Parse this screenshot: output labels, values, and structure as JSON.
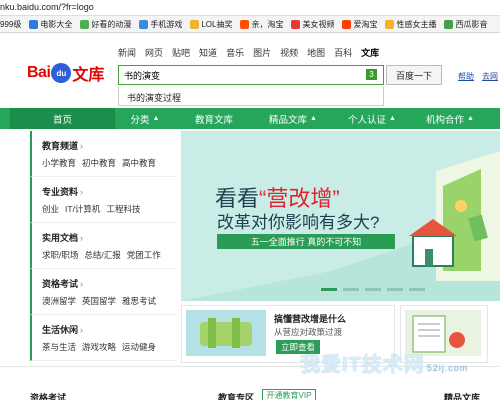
{
  "url": "nku.baidu.com/?fr=logo",
  "bookmarks": [
    {
      "label": "999级",
      "color": "#ffffff"
    },
    {
      "label": "电影大全",
      "color": "#2e7ad8"
    },
    {
      "label": "好看的动漫",
      "color": "#4caf50"
    },
    {
      "label": "手机游戏",
      "color": "#3a8bd8"
    },
    {
      "label": "LOL抽奖",
      "color": "#f0b429"
    },
    {
      "label": "亲，淘宝",
      "color": "#ff5000"
    },
    {
      "label": "美女视频",
      "color": "#e53935"
    },
    {
      "label": "爱淘宝",
      "color": "#ff3d00"
    },
    {
      "label": "性感女主播",
      "color": "#f0b429"
    },
    {
      "label": "西瓜影音",
      "color": "#43a047"
    }
  ],
  "topnav": [
    "新闻",
    "网页",
    "贴吧",
    "知道",
    "音乐",
    "图片",
    "视频",
    "地图",
    "百科",
    "文库"
  ],
  "logo": {
    "bai": "Bai",
    "du": "du",
    "wenku": "文库"
  },
  "search": {
    "value": "书的演变",
    "count": "3",
    "button": "百度一下",
    "help": "帮助",
    "goto": "去网"
  },
  "suggestion": "书的演变过程",
  "mainnav": [
    {
      "label": "首页",
      "arrow": false
    },
    {
      "label": "分类",
      "arrow": true
    },
    {
      "label": "教育文库",
      "arrow": false
    },
    {
      "label": "精品文库",
      "arrow": true
    },
    {
      "label": "个人认证",
      "arrow": true
    },
    {
      "label": "机构合作",
      "arrow": true
    }
  ],
  "categories": [
    {
      "title": "教育频道",
      "links": [
        "小学教育",
        "初中教育",
        "高中教育"
      ]
    },
    {
      "title": "专业资料",
      "links": [
        "创业",
        "IT/计算机",
        "工程科技"
      ]
    },
    {
      "title": "实用文档",
      "links": [
        "求职/职场",
        "总结/汇报",
        "党团工作"
      ]
    },
    {
      "title": "资格考试",
      "links": [
        "澳洲留学",
        "英国留学",
        "雅思考试"
      ]
    },
    {
      "title": "生活休闲",
      "links": [
        "茶与生活",
        "游戏攻略",
        "运动健身"
      ]
    }
  ],
  "banner": {
    "line1_a": "看看",
    "line1_q": "“营改增”",
    "line2": "改革对你影响有多大?",
    "bar": "五一全面推行 真的不可不知"
  },
  "promo": {
    "title": "搞懂营改增是什么",
    "subtitle": "从营应对政策过渡",
    "button": "立即查看"
  },
  "bottom": {
    "col1": "资格考试",
    "col2": "教育专区",
    "vip": "开通教育VIP",
    "col3": "精品文库"
  },
  "watermark": {
    "text": "我爱IT技术网",
    "sub": "52ij.com"
  }
}
